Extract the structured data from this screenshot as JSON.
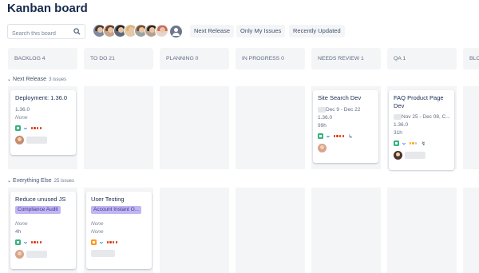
{
  "page": {
    "title": "Kanban board"
  },
  "search": {
    "placeholder": "Search this board",
    "icon": "search-icon"
  },
  "avatars": [
    {
      "name": "avatar-1",
      "hair": "#4a3a33",
      "bg": "#7d8aa0"
    },
    {
      "name": "avatar-2",
      "hair": "#6b3f2a",
      "bg": "#c9a38a"
    },
    {
      "name": "avatar-3",
      "hair": "#2e2622",
      "bg": "#5f6b7a"
    },
    {
      "name": "avatar-4",
      "hair": "#d9b27a",
      "bg": "#e3c9a8"
    },
    {
      "name": "avatar-5",
      "hair": "#7a4a2e",
      "bg": "#9aa5a0"
    },
    {
      "name": "avatar-6",
      "hair": "#2b211d",
      "bg": "#b7a08e"
    },
    {
      "name": "avatar-7",
      "hair": "#c46a5a",
      "bg": "#e7d5cc"
    }
  ],
  "filters": [
    "Next Release",
    "Only My Issues",
    "Recently Updated"
  ],
  "columns": [
    {
      "label": "BACKLOG 4"
    },
    {
      "label": "TO DO 21"
    },
    {
      "label": "PLANNING 0"
    },
    {
      "label": "IN PROGRESS 0"
    },
    {
      "label": "NEEDS REVIEW 1"
    },
    {
      "label": "QA 1"
    },
    {
      "label": "BLO"
    }
  ],
  "swimlanes": [
    {
      "label": "Next Release",
      "count": "3 issues"
    },
    {
      "label": "Everything Else",
      "count": "25 issues"
    }
  ],
  "cards": {
    "deployment": {
      "title": "Deployment: 1.36.0",
      "version": "1.36.0",
      "estimate": "None"
    },
    "site_search": {
      "title": "Site Search Dev",
      "dates": "Dec 9 - Dec 22",
      "version": "1.36.0",
      "estimate": "99h"
    },
    "faq": {
      "title": "FAQ Product Page Dev",
      "dates": "Nov 25 - Dec 08, C...",
      "version": "1.36.0",
      "estimate": "31h"
    },
    "reduce_js": {
      "title": "Reduce unused JS",
      "epic": "Compliance Audit",
      "version": "None",
      "estimate": "4h"
    },
    "user_testing": {
      "title": "User Testing",
      "epic": "Account Instant O...",
      "version": "None",
      "estimate": "None"
    }
  },
  "colors": {
    "story": "#36b37e",
    "bug_task": "#ff991f",
    "priority": "#0065ff",
    "dot_red": "#de350b",
    "dot_yellow": "#ffab00",
    "dot_grey": "#c1c7d0",
    "epic_bg": "#c0b6f2"
  }
}
